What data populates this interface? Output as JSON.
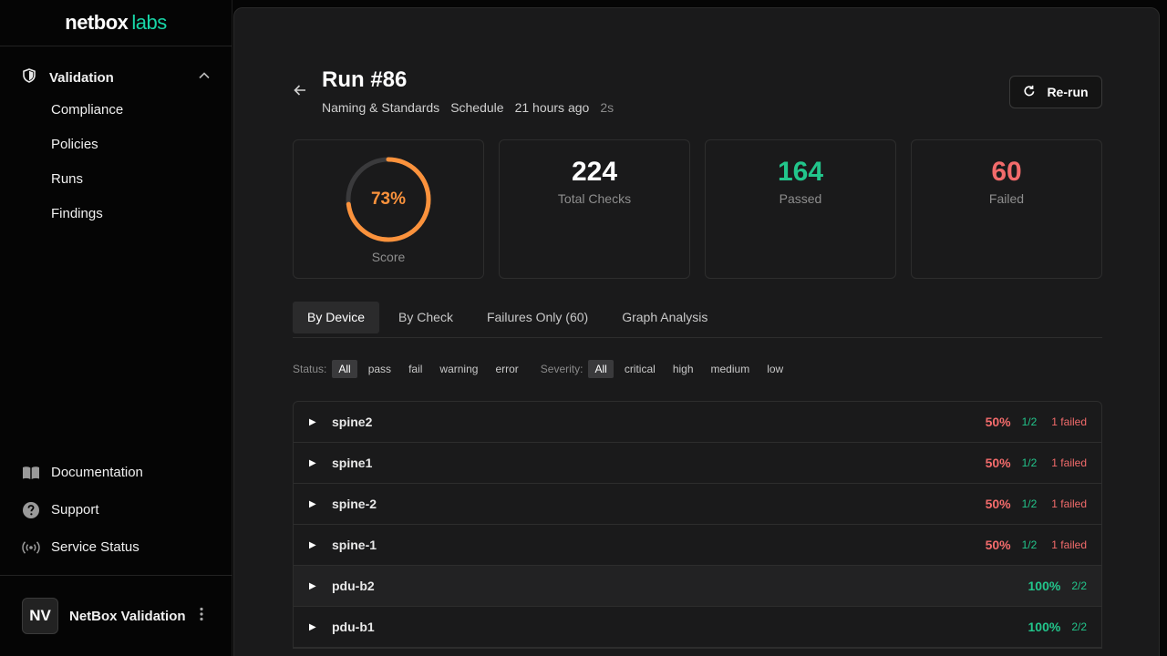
{
  "brand": {
    "part1": "netbox",
    "part2": "labs"
  },
  "sidebar": {
    "section": "Validation",
    "items": [
      {
        "label": "Compliance"
      },
      {
        "label": "Policies"
      },
      {
        "label": "Runs"
      },
      {
        "label": "Findings"
      }
    ],
    "bottom": [
      {
        "label": "Documentation",
        "icon": "book-icon"
      },
      {
        "label": "Support",
        "icon": "help-icon"
      },
      {
        "label": "Service Status",
        "icon": "broadcast-icon"
      }
    ],
    "user": {
      "initials": "NV",
      "name": "NetBox Validation"
    }
  },
  "run": {
    "title": "Run #86",
    "policy": "Naming & Standards",
    "trigger": "Schedule",
    "when": "21 hours ago",
    "duration": "2s",
    "rerun_label": "Re-run"
  },
  "stats": {
    "score": 73,
    "score_text": "73%",
    "score_label": "Score",
    "total": "224",
    "total_label": "Total Checks",
    "passed": "164",
    "passed_label": "Passed",
    "failed": "60",
    "failed_label": "Failed"
  },
  "tabs": [
    {
      "label": "By Device"
    },
    {
      "label": "By Check"
    },
    {
      "label": "Failures Only (60)"
    },
    {
      "label": "Graph Analysis"
    }
  ],
  "filters": {
    "status_label": "Status:",
    "status": [
      "All",
      "pass",
      "fail",
      "warning",
      "error"
    ],
    "severity_label": "Severity:",
    "severity": [
      "All",
      "critical",
      "high",
      "medium",
      "low"
    ]
  },
  "devices": [
    {
      "name": "spine2",
      "pct": "50%",
      "ratio": "1/2",
      "failed": "1 failed"
    },
    {
      "name": "spine1",
      "pct": "50%",
      "ratio": "1/2",
      "failed": "1 failed"
    },
    {
      "name": "spine-2",
      "pct": "50%",
      "ratio": "1/2",
      "failed": "1 failed"
    },
    {
      "name": "spine-1",
      "pct": "50%",
      "ratio": "1/2",
      "failed": "1 failed"
    },
    {
      "name": "pdu-b2",
      "pct": "100%",
      "ratio": "2/2",
      "failed": ""
    },
    {
      "name": "pdu-b1",
      "pct": "100%",
      "ratio": "2/2",
      "failed": ""
    }
  ],
  "colors": {
    "accent": "#18d6a8",
    "score": "#fb923c",
    "pass": "#22c58b",
    "fail": "#f26b6b"
  }
}
